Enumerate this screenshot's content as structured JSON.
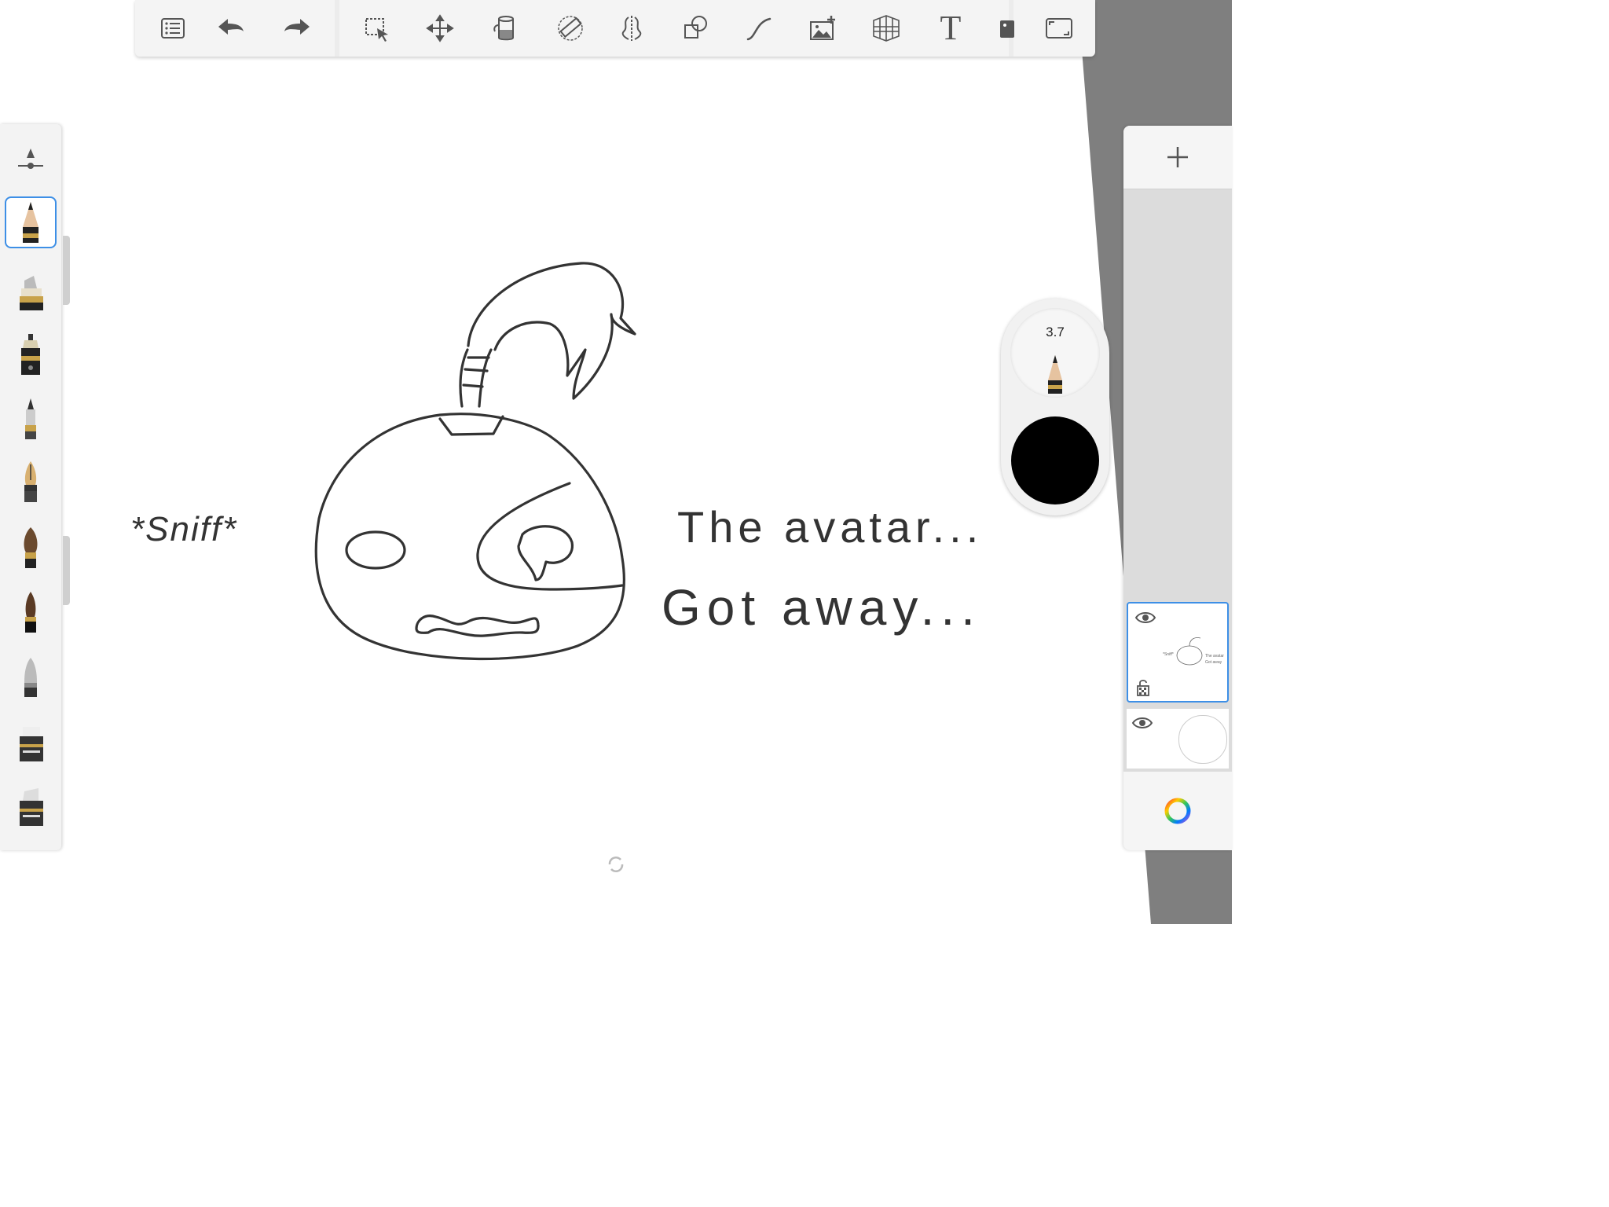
{
  "app": {
    "accent_color": "#3d8fe6",
    "background_color": "#ffffff",
    "sidebar_bg_color": "#f3f3f3"
  },
  "toolbar": {
    "items": [
      {
        "id": "list",
        "icon": "list-icon"
      },
      {
        "id": "undo",
        "icon": "undo-icon"
      },
      {
        "id": "redo",
        "icon": "redo-icon"
      },
      {
        "id": "select",
        "icon": "selection-icon"
      },
      {
        "id": "transform",
        "icon": "move-icon"
      },
      {
        "id": "fill",
        "icon": "paint-bucket-icon"
      },
      {
        "id": "ruler",
        "icon": "ruler-icon"
      },
      {
        "id": "symmetry",
        "icon": "symmetry-icon"
      },
      {
        "id": "shapes",
        "icon": "shapes-icon"
      },
      {
        "id": "stroke",
        "icon": "curve-icon"
      },
      {
        "id": "image",
        "icon": "add-image-icon"
      },
      {
        "id": "perspective",
        "icon": "perspective-grid-icon"
      },
      {
        "id": "text",
        "icon": "text-icon",
        "label": "T"
      },
      {
        "id": "tag",
        "icon": "tag-icon"
      },
      {
        "id": "fullscreen",
        "icon": "fullscreen-icon"
      }
    ]
  },
  "brushes": {
    "items": [
      {
        "name": "pencil",
        "selected": true
      },
      {
        "name": "marker"
      },
      {
        "name": "technical-pen"
      },
      {
        "name": "ballpoint-pen"
      },
      {
        "name": "fountain-pen"
      },
      {
        "name": "paint-brush"
      },
      {
        "name": "ink-brush"
      },
      {
        "name": "airbrush"
      },
      {
        "name": "chisel-marker"
      },
      {
        "name": "eraser"
      }
    ]
  },
  "puck": {
    "brush_size": "3.7",
    "current_color": "#000000"
  },
  "layers": {
    "add_label": "+",
    "items": [
      {
        "name": "drawing-layer",
        "visible": true,
        "selected": true
      },
      {
        "name": "background-layer",
        "visible": true,
        "selected": false
      }
    ]
  },
  "canvas": {
    "texts": {
      "sniff": "*Sniff*",
      "line1": "The avatar...",
      "line2": "Got away..."
    }
  }
}
